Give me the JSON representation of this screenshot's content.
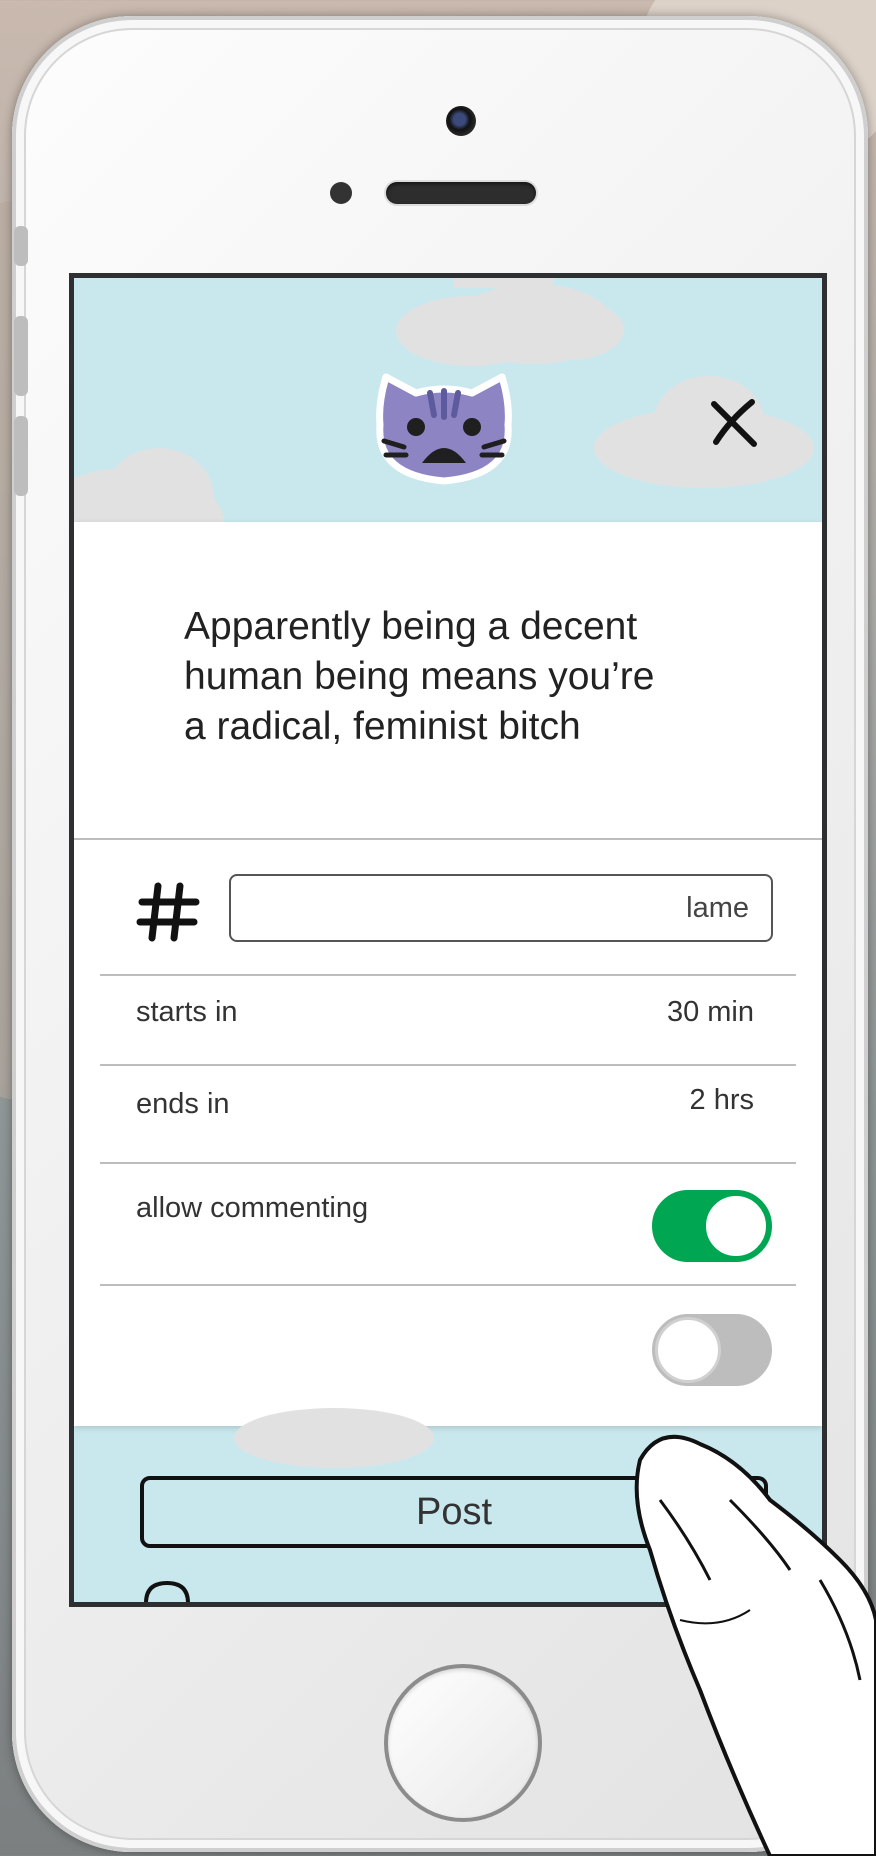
{
  "message": {
    "line1": "Apparently being a decent",
    "line2": "human being means you’re",
    "line3": "a radical, feminist bitch"
  },
  "hashtag": {
    "value": "lame"
  },
  "schedule": {
    "starts_label": "starts in",
    "starts_value": "30 min",
    "ends_label": "ends in",
    "ends_value": "2 hrs"
  },
  "settings": {
    "commenting_label": "allow commenting",
    "commenting_enabled": true,
    "private_enabled": false
  },
  "actions": {
    "post_label": "Post"
  },
  "colors": {
    "sky": "#c9e8ee",
    "toggle_on": "#00a651",
    "toggle_off": "#bdbdbd",
    "avatar": "#8d85c3"
  },
  "icons": {
    "avatar": "sad-cat-icon",
    "close": "close-icon",
    "hashtag": "hashtag-icon",
    "lock": "lock-icon"
  }
}
